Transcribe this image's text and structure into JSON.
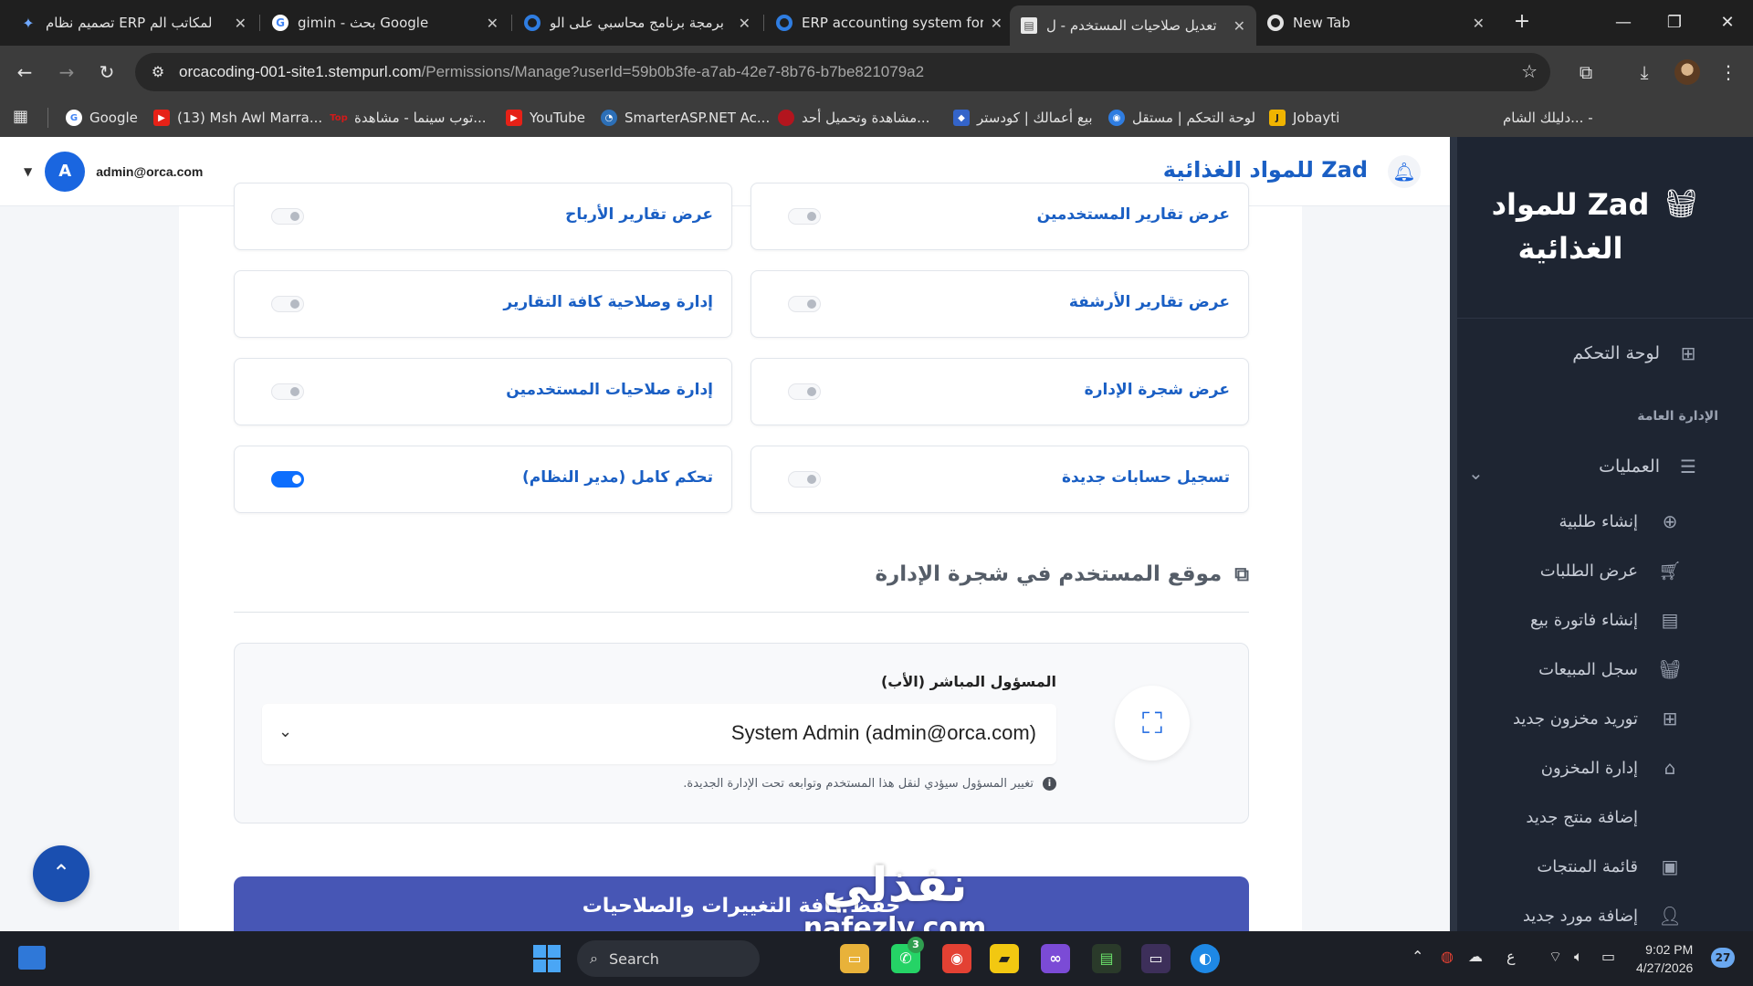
{
  "browser": {
    "tabs": [
      {
        "title": "تصميم نظام ERP لمكاتب الم",
        "icon": "gemini-icon"
      },
      {
        "title": "gimin - بحث Google",
        "icon": "google-icon"
      },
      {
        "title": "برمجة برنامج محاسبي على الو",
        "icon": "site-icon"
      },
      {
        "title": "ERP accounting system for",
        "icon": "site-icon"
      },
      {
        "title": "تعديل صلاحيات المستخدم - ل",
        "icon": "page-icon",
        "active": true
      },
      {
        "title": "New Tab",
        "icon": "chrome-icon"
      }
    ],
    "new_tab": "+",
    "url_host": "orcacoding-001-site1.stempurl.com",
    "url_path": "/Permissions/Manage?userId=59b0b3fe-a7ab-42e7-8b76-b7be821079a2",
    "bookmarks": [
      {
        "label": "Google",
        "color": "#ffffff"
      },
      {
        "label": "(13) Msh Awl Marra...",
        "color": "#e62117"
      },
      {
        "label": "توب سينما - مشاهدة...",
        "color": "#d11a1a"
      },
      {
        "label": "YouTube",
        "color": "#e62117"
      },
      {
        "label": "SmarterASP.NET Ac...",
        "color": "#2c6fb7"
      },
      {
        "label": "مشاهدة وتحميل أحد...",
        "color": "#b3151e"
      },
      {
        "label": "بيع أعمالك | كودستر",
        "color": "#3464c9"
      },
      {
        "label": "لوحة التحكم | مستقل",
        "color": "#2f7de1"
      },
      {
        "label": "Jobayti",
        "color": "#f0b400"
      },
      {
        "label": "دليلك الشام... -",
        "color": "#3c3c3c"
      }
    ]
  },
  "header": {
    "email": "admin@orca.com",
    "avatar_letter": "A",
    "brand": "Zad للمواد الغذائية"
  },
  "sidebar": {
    "brand": "Zad للمواد الغذائية",
    "dashboard": "لوحة التحكم",
    "section_label": "الإدارة العامة",
    "operations": "العمليات",
    "sub_items": [
      {
        "label": "إنشاء طلبية",
        "icon": "plus-circle-icon"
      },
      {
        "label": "عرض الطلبات",
        "icon": "cart-icon"
      },
      {
        "label": "إنشاء فاتورة بيع",
        "icon": "invoice-icon"
      },
      {
        "label": "سجل المبيعات",
        "icon": "basket-icon"
      },
      {
        "label": "توريد مخزون جديد",
        "icon": "plus-square-icon"
      },
      {
        "label": "إدارة المخزون",
        "icon": "warehouse-icon"
      },
      {
        "label": "إضافة منتج جديد",
        "icon": "none"
      },
      {
        "label": "قائمة المنتجات",
        "icon": "box-icon"
      },
      {
        "label": "إضافة مورد جديد",
        "icon": "user-plus-icon"
      }
    ]
  },
  "permissions": [
    {
      "label": "عرض تقارير المستخدمين",
      "enabled": false
    },
    {
      "label": "عرض تقارير الأرباح",
      "enabled": false
    },
    {
      "label": "عرض تقارير الأرشفة",
      "enabled": false
    },
    {
      "label": "إدارة وصلاحية كافة التقارير",
      "enabled": false
    },
    {
      "label": "عرض شجرة الإدارة",
      "enabled": false
    },
    {
      "label": "إدارة صلاحيات المستخدمين",
      "enabled": false
    },
    {
      "label": "تسجيل حسابات جديدة",
      "enabled": false
    },
    {
      "label": "تحكم كامل (مدير النظام)",
      "enabled": true
    }
  ],
  "tree_section": {
    "title": "موقع المستخدم في شجرة الإدارة",
    "parent_label": "المسؤول المباشر (الأب)",
    "parent_value": "System Admin (admin@orca.com)",
    "hint": "تغيير المسؤول سيؤدي لنقل هذا المستخدم وتوابعه تحت الإدارة الجديدة."
  },
  "save_button": "حفظ كافة التغييرات والصلاحيات",
  "watermark": {
    "text": "نفذلي",
    "sub": "nafezly.com"
  },
  "taskbar": {
    "search": "Search",
    "time": "9:02 PM",
    "date": "4/27/2026",
    "notifications": "27",
    "whatsapp_badge": "3",
    "lang": "ع"
  }
}
